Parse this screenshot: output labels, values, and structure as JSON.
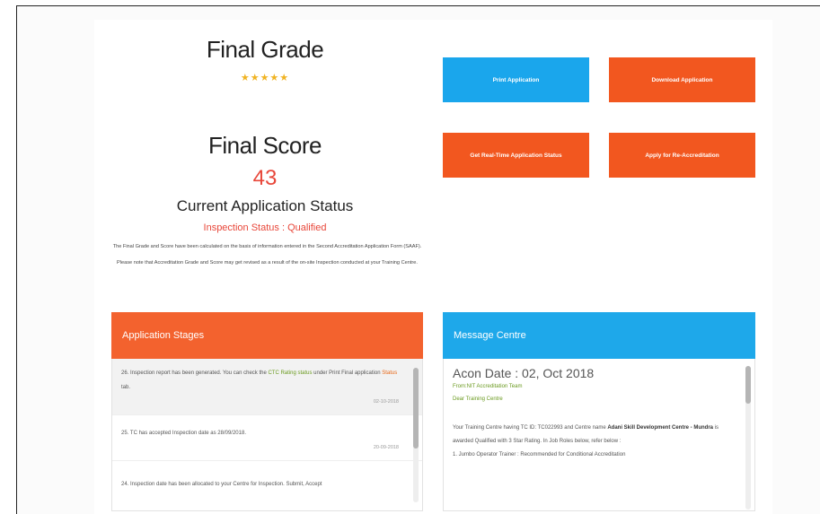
{
  "grade": {
    "title": "Final Grade",
    "stars": "★★★★★",
    "score_title": "Final Score",
    "score_value": "43",
    "status_title": "Current Application Status",
    "status_value": "Inspection Status : Qualified",
    "note": "The Final Grade and Score have been calculated on the basis of information entered in the Second Accreditation Application Form (SAAF). Please note that Accreditation Grade and Score may get revised as a result of the on-site Inspection conducted at your Training Centre."
  },
  "actions": {
    "print_application": "Print Application",
    "download_application": "Download Application",
    "last_new_application_status": "Get Real-Time Application Status",
    "apply_reaccreditation": "Apply for Re-Accreditation",
    "colors": {
      "blue": "#1aa6ec",
      "orange": "#f2571f"
    }
  },
  "stages": {
    "title": "Application Stages",
    "items": [
      {
        "text_a": "26. Inspection report has been generated. You can check the ",
        "text_link": "CTC Rating status",
        "text_b": " under Print Final application ",
        "text_link2": "Status",
        "text_c": " tab.",
        "date": "02-10-2018"
      },
      {
        "text_a": "25. TC has accepted Inspection date as 28/09/2018.",
        "text_link": "",
        "text_b": "",
        "text_link2": "",
        "text_c": "",
        "date": "20-09-2018"
      },
      {
        "text_a": "24. Inspection date has been allocated to your Centre for Inspection. Submit, Accept",
        "text_link": "",
        "text_b": "",
        "text_link2": "",
        "text_c": "",
        "date": ""
      }
    ]
  },
  "messages": {
    "title": "Message Centre",
    "date": "Acon Date : 02, Oct 2018",
    "from": "From:NIT Accreditation Team",
    "to": "Dear Training Centre",
    "body_a": "Your Training Centre having TC ID: TC022993 and Centre name ",
    "body_bold": "Adani Skill Development Centre - Mundra",
    "body_b": " is awarded Qualified with 3 Star Rating. In Job Roles below, refer below :",
    "body_c": "1. Jumbo Operator Trainer : Recommended for Conditional Accreditation"
  }
}
